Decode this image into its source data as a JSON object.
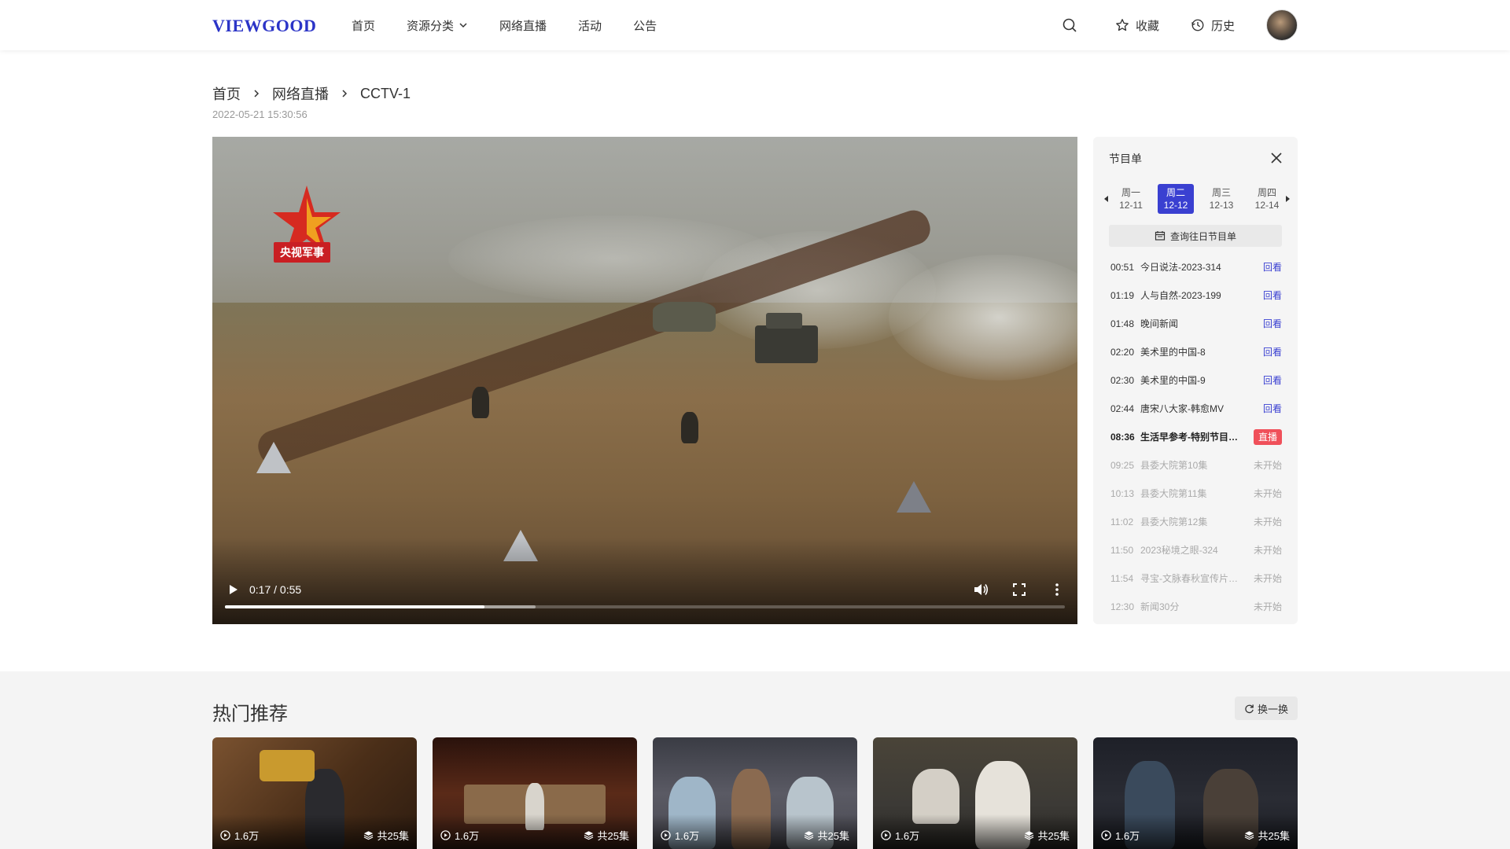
{
  "header": {
    "logo": "VIEWGOOD",
    "nav": [
      "首页",
      "资源分类",
      "网络直播",
      "活动",
      "公告"
    ],
    "favorites_label": "收藏",
    "history_label": "历史"
  },
  "breadcrumb": {
    "items": [
      "首页",
      "网络直播",
      "CCTV-1"
    ],
    "datetime": "2022-05-21  15:30:56"
  },
  "video": {
    "channel_logo_text": "央视军事",
    "time_display": "0:17 / 0:55",
    "progress_fraction": 0.309,
    "buffer_fraction": 0.37
  },
  "schedule": {
    "title": "节目单",
    "days": [
      {
        "week": "周一",
        "date": "12-11",
        "active": false
      },
      {
        "week": "周二",
        "date": "12-12",
        "active": true
      },
      {
        "week": "周三",
        "date": "12-13",
        "active": false
      },
      {
        "week": "周四",
        "date": "12-14",
        "active": false
      }
    ],
    "query_label": "查询往日节目单",
    "programs": [
      {
        "time": "00:51",
        "name": "今日说法-2023-314",
        "status": "回看",
        "state": "replay"
      },
      {
        "time": "01:19",
        "name": "人与自然-2023-199",
        "status": "回看",
        "state": "replay"
      },
      {
        "time": "01:48",
        "name": "晚间新闻",
        "status": "回看",
        "state": "replay"
      },
      {
        "time": "02:20",
        "name": "美术里的中国-8",
        "status": "回看",
        "state": "replay"
      },
      {
        "time": "02:30",
        "name": "美术里的中国-9",
        "status": "回看",
        "state": "replay"
      },
      {
        "time": "02:44",
        "name": "唐宋八大家-韩愈MV",
        "status": "回看",
        "state": "replay"
      },
      {
        "time": "08:36",
        "name": "生活早参考-特别节目…",
        "status": "直播",
        "state": "live"
      },
      {
        "time": "09:25",
        "name": "县委大院第10集",
        "status": "未开始",
        "state": "future"
      },
      {
        "time": "10:13",
        "name": "县委大院第11集",
        "status": "未开始",
        "state": "future"
      },
      {
        "time": "11:02",
        "name": "县委大院第12集",
        "status": "未开始",
        "state": "future"
      },
      {
        "time": "11:50",
        "name": "2023秘境之眼-324",
        "status": "未开始",
        "state": "future"
      },
      {
        "time": "11:54",
        "name": "寻宝-文脉春秋宣传片…",
        "status": "未开始",
        "state": "future"
      },
      {
        "time": "12:30",
        "name": "新闻30分",
        "status": "未开始",
        "state": "future"
      }
    ]
  },
  "recommend": {
    "title": "热门推荐",
    "refresh_label": "换一换",
    "cards": [
      {
        "views": "1.6万",
        "episodes": "共25集",
        "theme": "#5a3a22"
      },
      {
        "views": "1.6万",
        "episodes": "共25集",
        "theme": "#3a1e14"
      },
      {
        "views": "1.6万",
        "episodes": "共25集",
        "theme": "#4a4a52"
      },
      {
        "views": "1.6万",
        "episodes": "共25集",
        "theme": "#3c3a36"
      },
      {
        "views": "1.6万",
        "episodes": "共25集",
        "theme": "#2a2c34"
      }
    ]
  },
  "colors": {
    "accent": "#3a40d1",
    "live": "#f0505a",
    "logo": "#2b34c7"
  }
}
